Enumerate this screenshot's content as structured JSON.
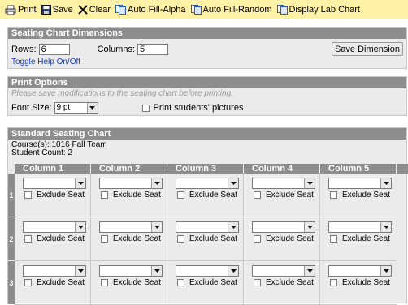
{
  "toolbar": {
    "print": "Print",
    "save": "Save",
    "clear": "Clear",
    "auto_fill_alpha": "Auto Fill-Alpha",
    "auto_fill_random": "Auto Fill-Random",
    "display_lab_chart": "Display Lab Chart"
  },
  "dimensions": {
    "title": "Seating Chart Dimensions",
    "rows_label": "Rows:",
    "rows_value": "6",
    "columns_label": "Columns:",
    "columns_value": "5",
    "save_button": "Save Dimension",
    "help_link": "Toggle Help On/Off"
  },
  "print_options": {
    "title": "Print Options",
    "note": "Please save modifications to the seating chart before printing.",
    "font_size_label": "Font Size:",
    "font_size_value": "9 pt",
    "print_pictures_label": "Print students' pictures"
  },
  "chart": {
    "title": "Standard Seating Chart",
    "courses": "Course(s): 1016 Fall Team",
    "student_count": "Student Count: 2",
    "columns": [
      "Column 1",
      "Column 2",
      "Column 3",
      "Column 4",
      "Column 5"
    ],
    "rows": [
      "1",
      "2",
      "3"
    ],
    "exclude_label": "Exclude Seat",
    "seat_value": ""
  }
}
